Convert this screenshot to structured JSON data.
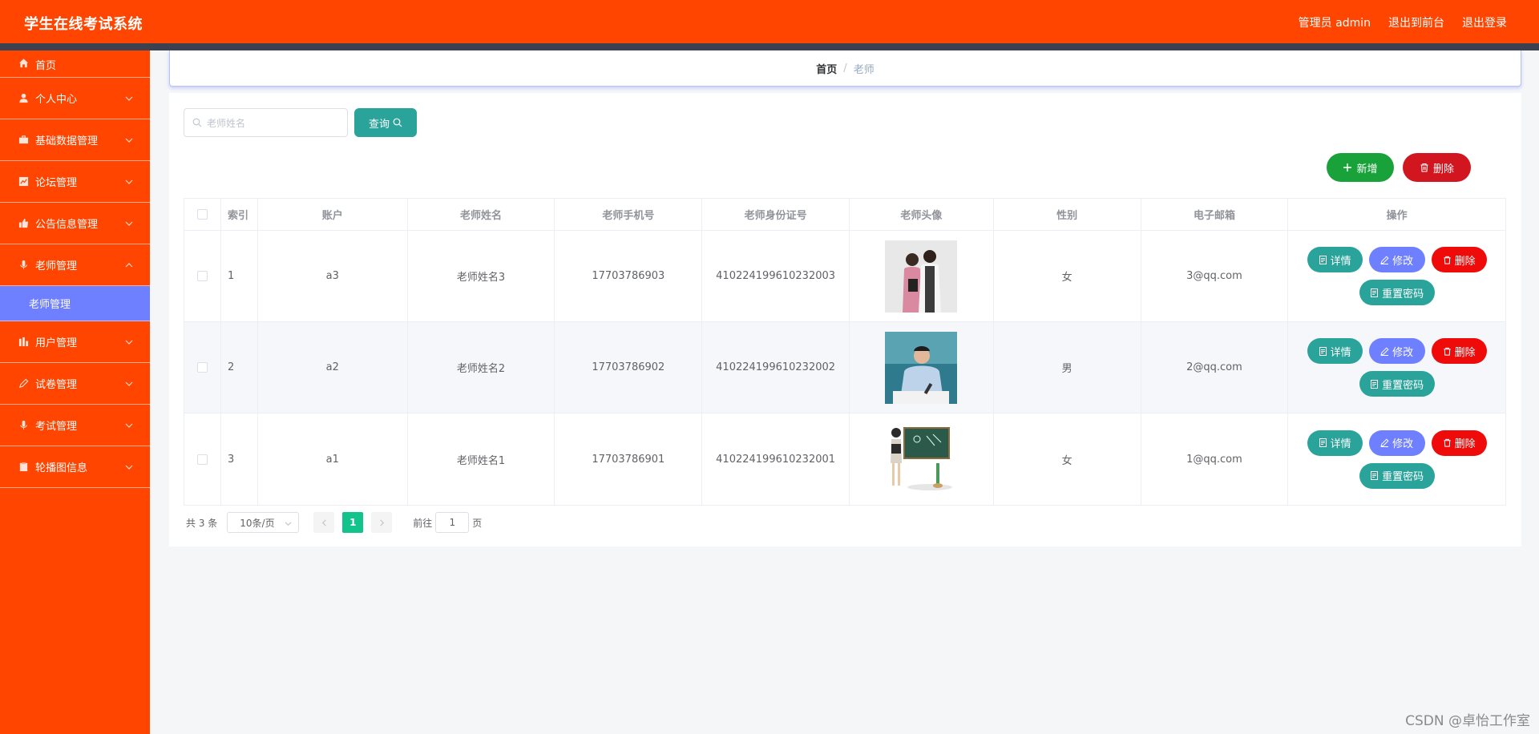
{
  "app": {
    "title": "学生在线考试系统",
    "admin_label": "管理员 admin",
    "exit_front": "退出到前台",
    "logout": "退出登录"
  },
  "colors": {
    "header": "#ff4500",
    "sidebar": "#ff4500",
    "submenu_active": "#6e7fff",
    "primary_teal": "#2aa39b",
    "add_green": "#1aa23a",
    "danger_red": "#d2161f",
    "page_active": "#13c38c"
  },
  "sidebar": {
    "items": [
      {
        "label": "首页",
        "icon": "home-icon"
      },
      {
        "label": "个人中心",
        "icon": "user-icon"
      },
      {
        "label": "基础数据管理",
        "icon": "briefcase-icon"
      },
      {
        "label": "论坛管理",
        "icon": "chart-icon"
      },
      {
        "label": "公告信息管理",
        "icon": "thumb-icon"
      },
      {
        "label": "老师管理",
        "icon": "mic-icon"
      },
      {
        "label": "用户管理",
        "icon": "bar-icon"
      },
      {
        "label": "试卷管理",
        "icon": "edit-icon"
      },
      {
        "label": "考试管理",
        "icon": "mic-icon"
      },
      {
        "label": "轮播图信息",
        "icon": "clipboard-icon"
      }
    ],
    "submenu": {
      "label": "老师管理"
    }
  },
  "breadcrumb": {
    "home": "首页",
    "separator": "/",
    "current": "老师"
  },
  "search": {
    "placeholder": "老师姓名",
    "button": "查询"
  },
  "actions": {
    "add": "新增",
    "delete": "删除"
  },
  "table": {
    "headers": [
      "索引",
      "账户",
      "老师姓名",
      "老师手机号",
      "老师身份证号",
      "老师头像",
      "性别",
      "电子邮箱",
      "操作"
    ],
    "rows": [
      {
        "index": "1",
        "account": "a3",
        "name": "老师姓名3",
        "phone": "17703786903",
        "id_card": "410224199610232003",
        "avatar": "two-women-teachers-photo",
        "gender": "女",
        "email": "3@qq.com"
      },
      {
        "index": "2",
        "account": "a2",
        "name": "老师姓名2",
        "phone": "17703786902",
        "id_card": "410224199610232002",
        "avatar": "man-writing-at-desk-photo",
        "gender": "男",
        "email": "2@qq.com"
      },
      {
        "index": "3",
        "account": "a1",
        "name": "老师姓名1",
        "phone": "17703786901",
        "id_card": "410224199610232001",
        "avatar": "teacher-at-blackboard-illustration",
        "gender": "女",
        "email": "1@qq.com"
      }
    ],
    "row_actions": {
      "detail": "详情",
      "edit": "修改",
      "remove": "删除",
      "reset": "重置密码"
    }
  },
  "pagination": {
    "total": "共 3 条",
    "page_size": "10条/页",
    "current_page": "1",
    "goto_label": "前往",
    "goto_value": "1",
    "page_unit": "页"
  },
  "watermark": "CSDN @卓怡工作室"
}
